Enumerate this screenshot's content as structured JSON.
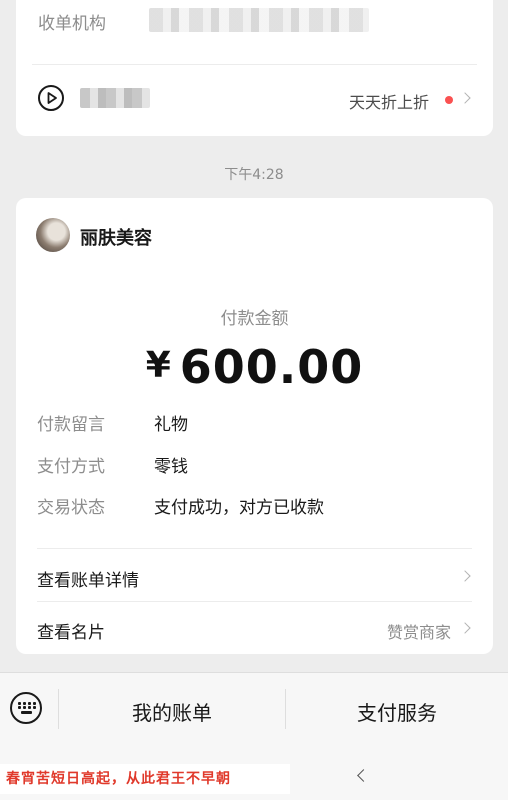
{
  "top_card": {
    "acquirer_label": "收单机构",
    "promo_text": "天天折上折"
  },
  "timestamp": "下午4:28",
  "receipt": {
    "merchant_name": "丽肤美容",
    "amount_label": "付款金额",
    "currency_symbol": "¥",
    "amount": "600.00",
    "details": [
      {
        "label": "付款留言",
        "value": "礼物"
      },
      {
        "label": "支付方式",
        "value": "零钱"
      },
      {
        "label": "交易状态",
        "value": "支付成功，对方已收款"
      }
    ],
    "bill_details_label": "查看账单详情",
    "business_card_label": "查看名片",
    "business_card_extra": "赞赏商家"
  },
  "bottom_menu": {
    "my_bills": "我的账单",
    "payment_services": "支付服务"
  },
  "footer_caption": "春宵苦短日高起，从此君王不早朝",
  "colors": {
    "background": "#ededed",
    "card": "#ffffff",
    "promo_dot": "#fa5151",
    "caption": "#e0392b"
  }
}
